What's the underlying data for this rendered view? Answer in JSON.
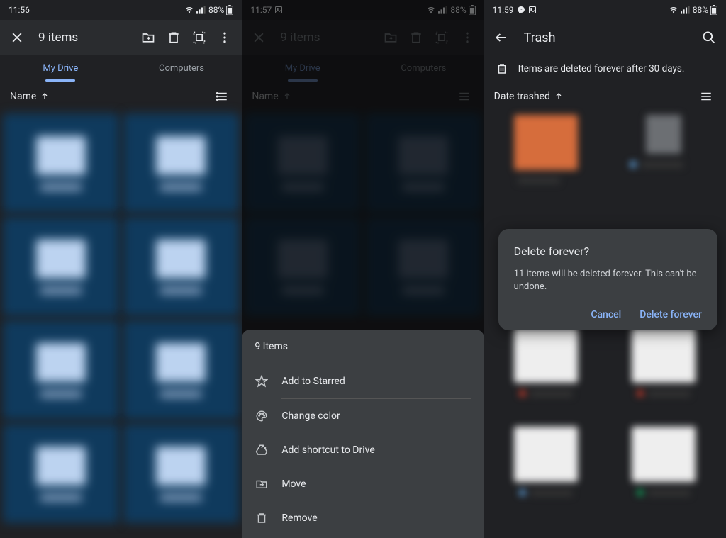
{
  "panel1": {
    "status": {
      "time": "11:56",
      "battery": "88%"
    },
    "toolbar": {
      "title": "9 items"
    },
    "tabs": {
      "my_drive": "My Drive",
      "computers": "Computers"
    },
    "sort": {
      "label": "Name"
    }
  },
  "panel2": {
    "status": {
      "time": "11:57",
      "battery": "88%"
    },
    "toolbar": {
      "title": "9 items"
    },
    "tabs": {
      "my_drive": "My Drive",
      "computers": "Computers"
    },
    "sort": {
      "label": "Name"
    },
    "sheet": {
      "header": "9 Items",
      "items": [
        {
          "label": "Add to Starred"
        },
        {
          "label": "Change color"
        },
        {
          "label": "Add shortcut to Drive"
        },
        {
          "label": "Move"
        },
        {
          "label": "Remove"
        }
      ]
    }
  },
  "panel3": {
    "status": {
      "time": "11:59",
      "battery": "88%"
    },
    "toolbar": {
      "title": "Trash"
    },
    "info": "Items are deleted forever after 30 days.",
    "sort": {
      "label": "Date trashed"
    },
    "dialog": {
      "title": "Delete forever?",
      "body": "11 items will be deleted forever. This can't be undone.",
      "cancel": "Cancel",
      "confirm": "Delete forever"
    }
  }
}
